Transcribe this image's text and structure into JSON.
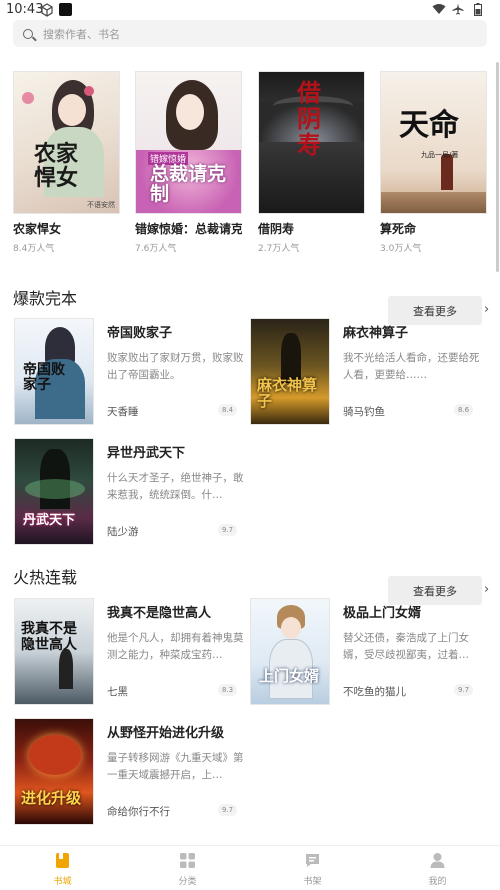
{
  "status": {
    "time": "10:43"
  },
  "search": {
    "placeholder": "搜索作者、书名"
  },
  "top_books": [
    {
      "title": "农家悍女",
      "popularity": "8.4万人气",
      "cover_text": "农家悍女",
      "cover_sub": "不语安然"
    },
    {
      "title": "错嫁惊婚：总裁请克制",
      "popularity": "7.6万人气",
      "cover_text": "总裁请克制",
      "cover_sub": "错嫁惊婚"
    },
    {
      "title": "借阴寿",
      "popularity": "2.7万人气",
      "cover_text": "借阴寿",
      "cover_sub": ""
    },
    {
      "title": "算死命",
      "popularity": "3.0万人气",
      "cover_text": "天命",
      "cover_sub": "九品一局/著"
    }
  ],
  "sections": [
    {
      "title": "爆款完本",
      "more_label": "查看更多",
      "books": [
        {
          "title": "帝国败家子",
          "desc": "败家败出了家财万贯，败家败出了帝国霸业。",
          "author": "天香睡",
          "score": "8.4",
          "cover_text": "帝国败家子"
        },
        {
          "title": "麻衣神算子",
          "desc": "我不光给活人看命，还要给死人看，更要给……",
          "author": "骑马钓鱼",
          "score": "8.6",
          "cover_text": "麻衣神算子"
        },
        {
          "title": "异世丹武天下",
          "desc": "什么天才圣子，绝世神子，敢来惹我，统统踩倒。什…",
          "author": "陆少游",
          "score": "9.7",
          "cover_text": "丹武天下"
        }
      ]
    },
    {
      "title": "火热连载",
      "more_label": "查看更多",
      "books": [
        {
          "title": "我真不是隐世高人",
          "desc": "他是个凡人，却拥有着神鬼莫测之能力，种菜成宝药…",
          "author": "七黑",
          "score": "8.3",
          "cover_text": "我真不是隐世高人"
        },
        {
          "title": "极品上门女婿",
          "desc": "替父还债，秦浩成了上门女婿，受尽歧视鄙夷，过着…",
          "author": "不吃鱼的猫儿",
          "score": "9.7",
          "cover_text": "上门女婿"
        },
        {
          "title": "从野怪开始进化升级",
          "desc": "量子转移网游《九重天域》第一重天域震撼开启，上…",
          "author": "命给你行不行",
          "score": "9.7",
          "cover_text": "进化升级"
        }
      ]
    }
  ],
  "tabs": [
    {
      "label": "书城",
      "icon": "book-icon"
    },
    {
      "label": "分类",
      "icon": "grid-icon"
    },
    {
      "label": "书架",
      "icon": "message-icon"
    },
    {
      "label": "我的",
      "icon": "person-icon"
    }
  ],
  "colors": {
    "accent": "#f2a400"
  }
}
